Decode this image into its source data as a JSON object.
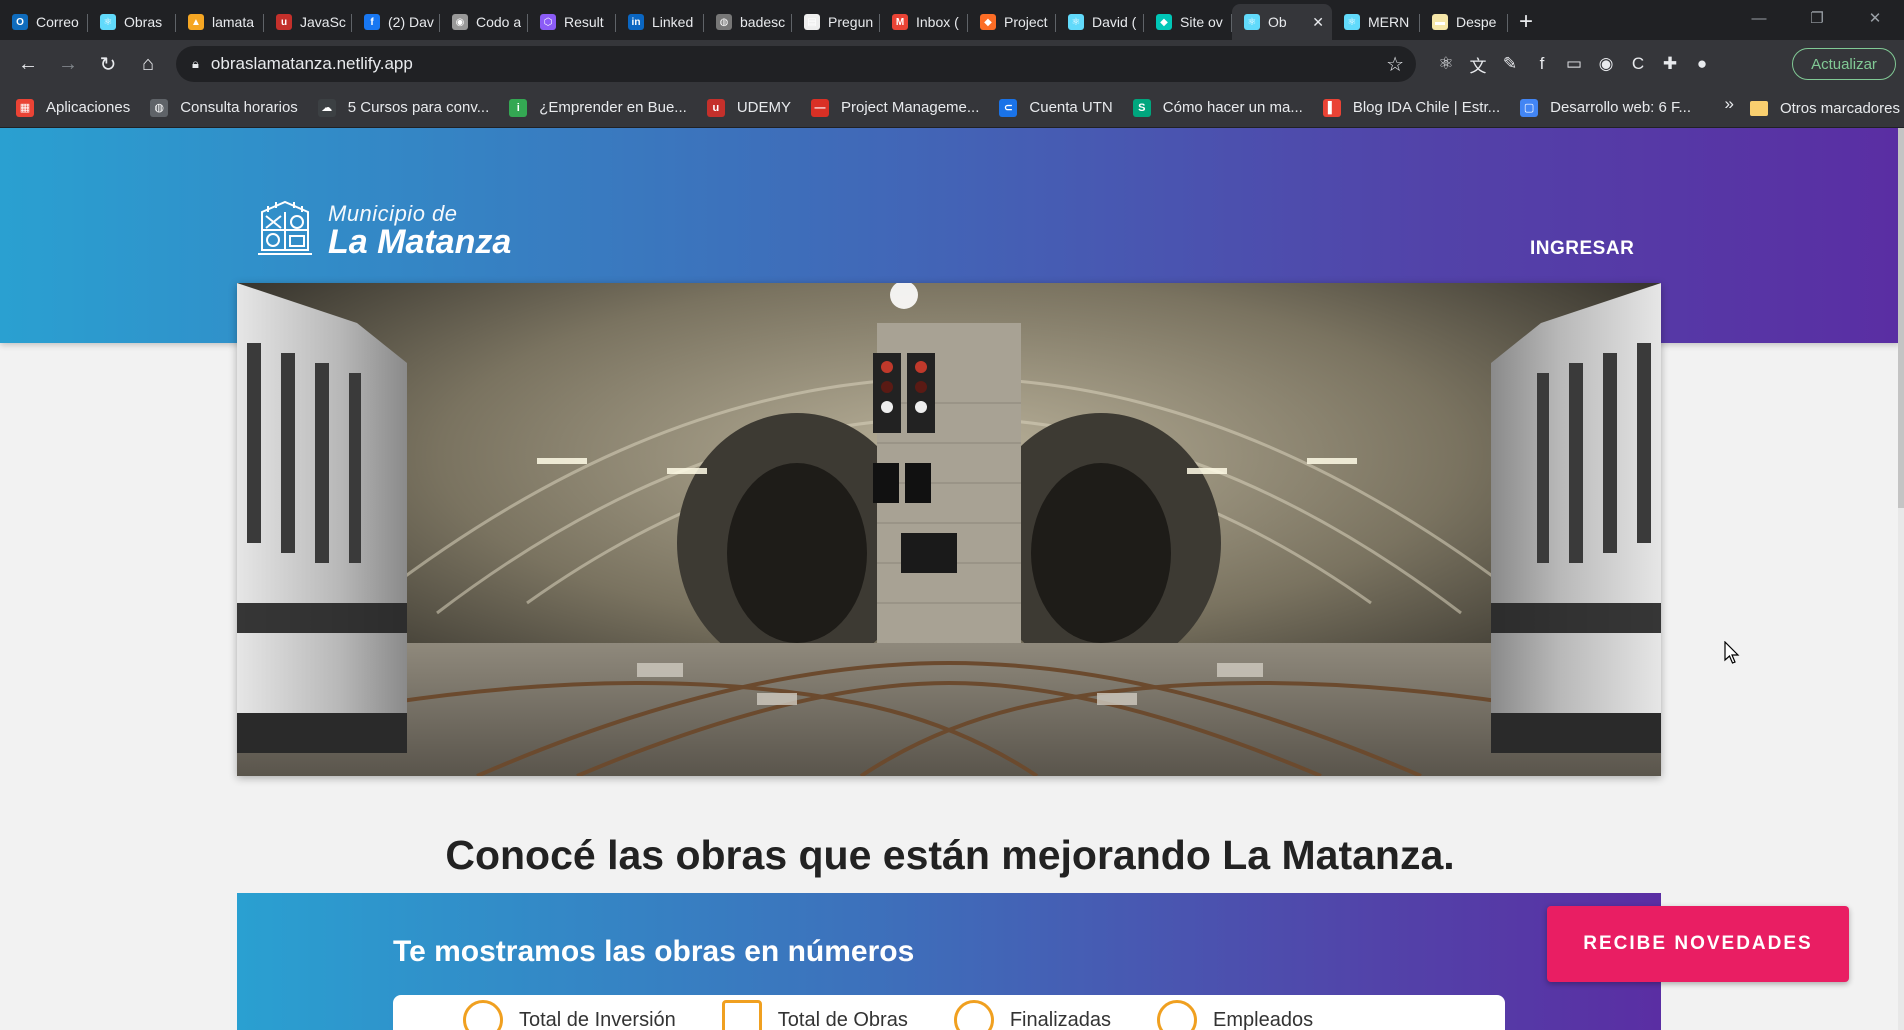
{
  "browser": {
    "tabs": [
      {
        "title": "Correo",
        "icon_color": "#0f6cbd",
        "icon": "outlook-icon",
        "glyph": "O"
      },
      {
        "title": "Obras",
        "icon_color": "#61dafb",
        "icon": "react-icon",
        "glyph": "⚛"
      },
      {
        "title": "lamata",
        "icon_color": "#f5a623",
        "icon": "firebase-icon",
        "glyph": "▲"
      },
      {
        "title": "JavaSc",
        "icon_color": "#c4302b",
        "icon": "udemy-icon",
        "glyph": "u"
      },
      {
        "title": "(2) Dav",
        "icon_color": "#1877f2",
        "icon": "facebook-icon",
        "glyph": "f"
      },
      {
        "title": "Codo a",
        "icon_color": "#999999",
        "icon": "chrome-icon",
        "glyph": "◉"
      },
      {
        "title": "Result",
        "icon_color": "#8b5cf6",
        "icon": "hexagon-icon",
        "glyph": "⬡"
      },
      {
        "title": "Linked",
        "icon_color": "#0a66c2",
        "icon": "linkedin-icon",
        "glyph": "in"
      },
      {
        "title": "badesc",
        "icon_color": "#777777",
        "icon": "globe-icon",
        "glyph": "◍"
      },
      {
        "title": "Pregun",
        "icon_color": "#eeeeee",
        "icon": "page-icon",
        "glyph": "▤"
      },
      {
        "title": "Inbox (",
        "icon_color": "#ea4335",
        "icon": "gmail-icon",
        "glyph": "M"
      },
      {
        "title": "Project",
        "icon_color": "#fc6d26",
        "icon": "gitlab-icon",
        "glyph": "◆"
      },
      {
        "title": "David (",
        "icon_color": "#61dafb",
        "icon": "react-icon",
        "glyph": "⚛"
      },
      {
        "title": "Site ov",
        "icon_color": "#00c7b7",
        "icon": "netlify-icon",
        "glyph": "◆"
      },
      {
        "title": "Ob",
        "icon_color": "#61dafb",
        "icon": "react-icon",
        "glyph": "⚛",
        "active": true
      },
      {
        "title": "MERN",
        "icon_color": "#61dafb",
        "icon": "react-icon",
        "glyph": "⚛"
      },
      {
        "title": "Despe",
        "icon_color": "#f5e6a8",
        "icon": "note-icon",
        "glyph": "▬"
      }
    ],
    "url": "obraslamatanza.netlify.app",
    "update_label": "Actualizar",
    "bookmarks": [
      {
        "label": "Aplicaciones",
        "icon_color": "#ea4335",
        "icon": "apps-grid-icon",
        "glyph": "▦"
      },
      {
        "label": "Consulta horarios",
        "icon_color": "#5f6368",
        "icon": "globe-icon",
        "glyph": "◍"
      },
      {
        "label": "5 Cursos para conv...",
        "icon_color": "#3c4043",
        "icon": "cloud-icon",
        "glyph": "☁"
      },
      {
        "label": "¿Emprender en Bue...",
        "icon_color": "#34a853",
        "icon": "info-icon",
        "glyph": "i"
      },
      {
        "label": "UDEMY",
        "icon_color": "#c4302b",
        "icon": "udemy-icon",
        "glyph": "u"
      },
      {
        "label": "Project Manageme...",
        "icon_color": "#d93025",
        "icon": "dash-icon",
        "glyph": "—"
      },
      {
        "label": "Cuenta UTN",
        "icon_color": "#1a73e8",
        "icon": "swirl-icon",
        "glyph": "⊂"
      },
      {
        "label": "Cómo hacer un ma...",
        "icon_color": "#00a67e",
        "icon": "s-icon",
        "glyph": "S"
      },
      {
        "label": "Blog IDA Chile | Estr...",
        "icon_color": "#ea4335",
        "icon": "bookmark-icon",
        "glyph": "▌"
      },
      {
        "label": "Desarrollo web: 6 F...",
        "icon_color": "#4285f4",
        "icon": "page-icon",
        "glyph": "▢"
      }
    ],
    "other_bookmarks": "Otros marcadores"
  },
  "page": {
    "logo_line1": "Municipio de",
    "logo_line2": "La Matanza",
    "login_label": "INGRESAR",
    "headline": "Conocé las obras que están mejorando La Matanza.",
    "stats_title": "Te mostramos las obras en números",
    "stats": [
      {
        "label": "Total de Inversión"
      },
      {
        "label": "Total de Obras"
      },
      {
        "label": "Finalizadas"
      },
      {
        "label": "Empleados"
      }
    ],
    "newsletter_label": "RECIBE NOVEDADES"
  },
  "colors": {
    "gradient_start": "#2aa0d1",
    "gradient_end": "#5a2ea3",
    "accent_button": "#e91e63"
  }
}
